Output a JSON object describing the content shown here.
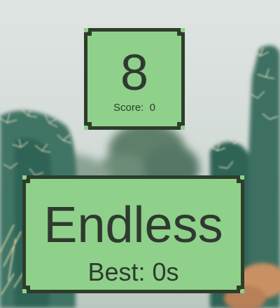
{
  "score_card": {
    "value": "8",
    "label": "Score:  0"
  },
  "mode_card": {
    "title": "Endless",
    "best": "Best: 0s"
  },
  "colors": {
    "panel_fill": "#8fd18b",
    "panel_border": "#2d3d2a",
    "text": "#2f3a2f"
  }
}
